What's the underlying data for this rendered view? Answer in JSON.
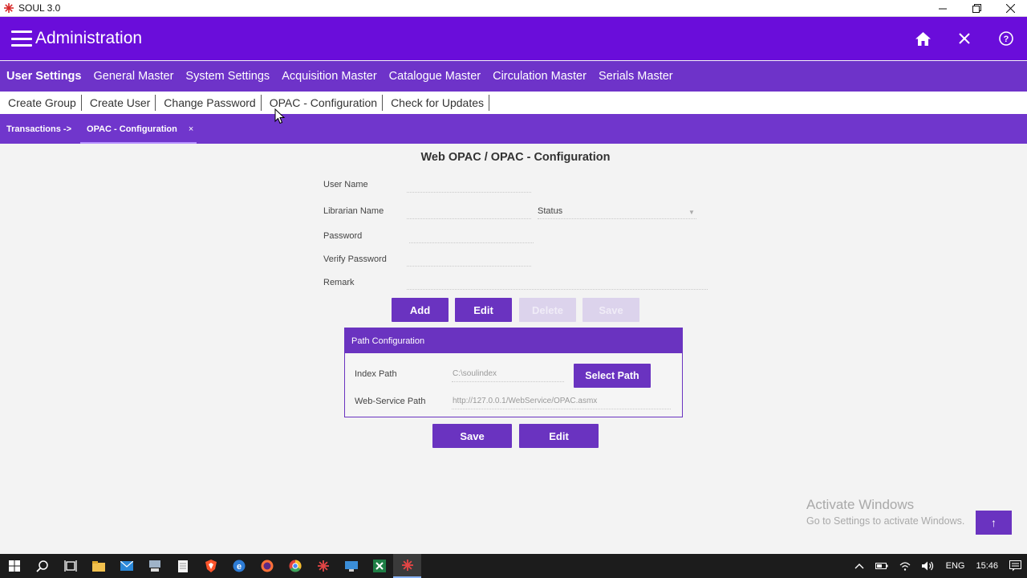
{
  "window": {
    "title": "SOUL 3.0",
    "controls": [
      "minimize-icon",
      "restore-icon",
      "close-icon"
    ]
  },
  "header": {
    "title": "Administration",
    "icons": [
      "home-icon",
      "close-icon",
      "help-icon"
    ],
    "color": "#6a0dda"
  },
  "main_menu": [
    {
      "label": "User Settings",
      "active": true
    },
    {
      "label": "General Master"
    },
    {
      "label": "System Settings"
    },
    {
      "label": "Acquisition Master"
    },
    {
      "label": "Catalogue Master"
    },
    {
      "label": "Circulation Master"
    },
    {
      "label": "Serials Master"
    }
  ],
  "sub_menu": [
    "Create Group",
    "Create User",
    "Change Password",
    "OPAC - Configuration",
    "Check for Updates"
  ],
  "tabs": {
    "breadcrumb": "Transactions ->",
    "active_tab": "OPAC - Configuration",
    "close": "×"
  },
  "form": {
    "title": "Web OPAC / OPAC - Configuration",
    "fields": {
      "user_name": "User Name",
      "librarian_name": "Librarian Name",
      "status": "Status",
      "password": "Password",
      "verify_password": "Verify Password",
      "remark": "Remark"
    },
    "buttons": {
      "add": "Add",
      "edit": "Edit",
      "delete": "Delete",
      "save": "Save"
    }
  },
  "path_config": {
    "heading": "Path Configuration",
    "index_path_label": "Index Path",
    "index_path_value": "C:\\soulindex",
    "select_path": "Select Path",
    "webservice_label": "Web-Service Path",
    "webservice_value": "http://127.0.0.1/WebService/OPAC.asmx"
  },
  "bottom_buttons": {
    "save": "Save",
    "edit": "Edit"
  },
  "watermark": {
    "line1": "Activate Windows",
    "line2": "Go to Settings to activate Windows."
  },
  "scroll_top": "↑",
  "taskbar": {
    "language": "ENG",
    "time": "15:46"
  },
  "accent_color": "#6a33c0"
}
